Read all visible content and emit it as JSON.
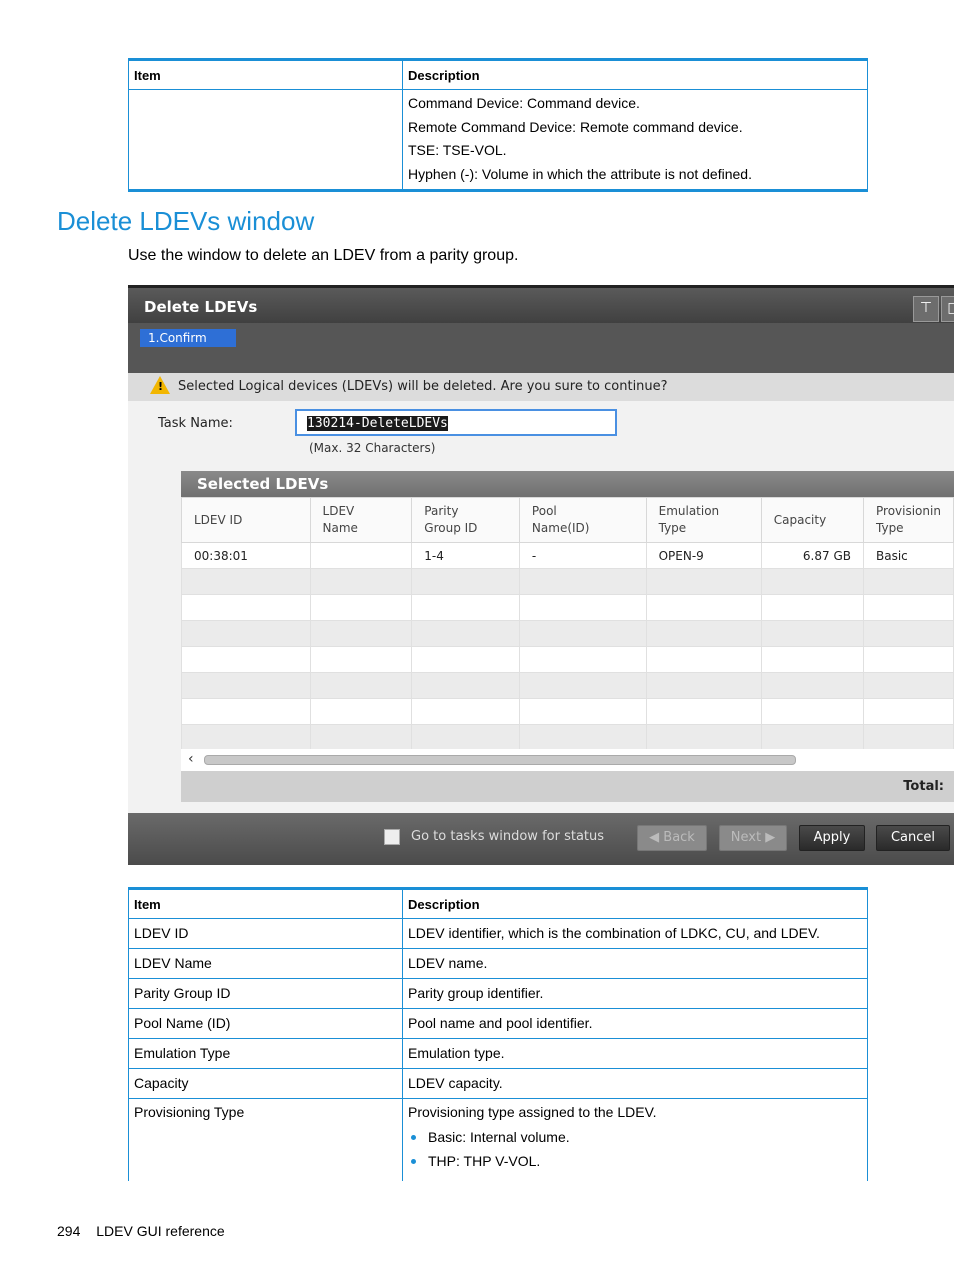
{
  "table1": {
    "headers": [
      "Item",
      "Description"
    ],
    "desc_lines": [
      "Command Device: Command device.",
      "Remote Command Device: Remote command device.",
      "TSE: TSE-VOL.",
      "Hyphen (-): Volume in which the attribute is not defined."
    ]
  },
  "section": {
    "title": "Delete LDEVs window",
    "intro": "Use the window to delete an LDEV from a parity group."
  },
  "window": {
    "title": "Delete LDEVs",
    "step": "1.Confirm",
    "warning": "Selected Logical devices (LDEVs) will be deleted. Are you sure to continue?",
    "task_label": "Task Name:",
    "task_value": "130214-DeleteLDEVs",
    "task_hint": "(Max. 32 Characters)",
    "selected_title": "Selected LDEVs",
    "columns": [
      "LDEV ID",
      "LDEV Name",
      "Parity Group ID",
      "Pool Name(ID)",
      "Emulation Type",
      "Capacity",
      "Provisioning Type"
    ],
    "columns_display": [
      "LDEV ID",
      "LDEV\nName",
      "Parity\nGroup ID",
      "Pool\nName(ID)",
      "Emulation\nType",
      "Capacity",
      "Provisionin\nType"
    ],
    "row": [
      "00:38:01",
      "",
      "1-4",
      "-",
      "OPEN-9",
      "6.87 GB",
      "Basic"
    ],
    "total_label": "Total:",
    "checkbox_label": "Go to tasks window for status",
    "buttons": {
      "back": "◀ Back",
      "next": "Next ▶",
      "apply": "Apply",
      "cancel": "Cancel"
    },
    "icons": [
      "pin-icon",
      "restore-icon",
      "warning-icon"
    ]
  },
  "table2": {
    "headers": [
      "Item",
      "Description"
    ],
    "rows": [
      {
        "item": "LDEV ID",
        "desc": "LDEV identifier, which is the combination of LDKC, CU, and LDEV."
      },
      {
        "item": "LDEV Name",
        "desc": "LDEV name."
      },
      {
        "item": "Parity Group ID",
        "desc": "Parity group identifier."
      },
      {
        "item": "Pool Name (ID)",
        "desc": "Pool name and pool identifier."
      },
      {
        "item": "Emulation Type",
        "desc": "Emulation type."
      },
      {
        "item": "Capacity",
        "desc": "LDEV capacity."
      }
    ],
    "last": {
      "item": "Provisioning Type",
      "desc": "Provisioning type assigned to the LDEV.",
      "bullets": [
        "Basic: Internal volume.",
        "THP: THP V-VOL."
      ]
    }
  },
  "footer": {
    "page": "294",
    "text": "LDEV GUI reference"
  }
}
